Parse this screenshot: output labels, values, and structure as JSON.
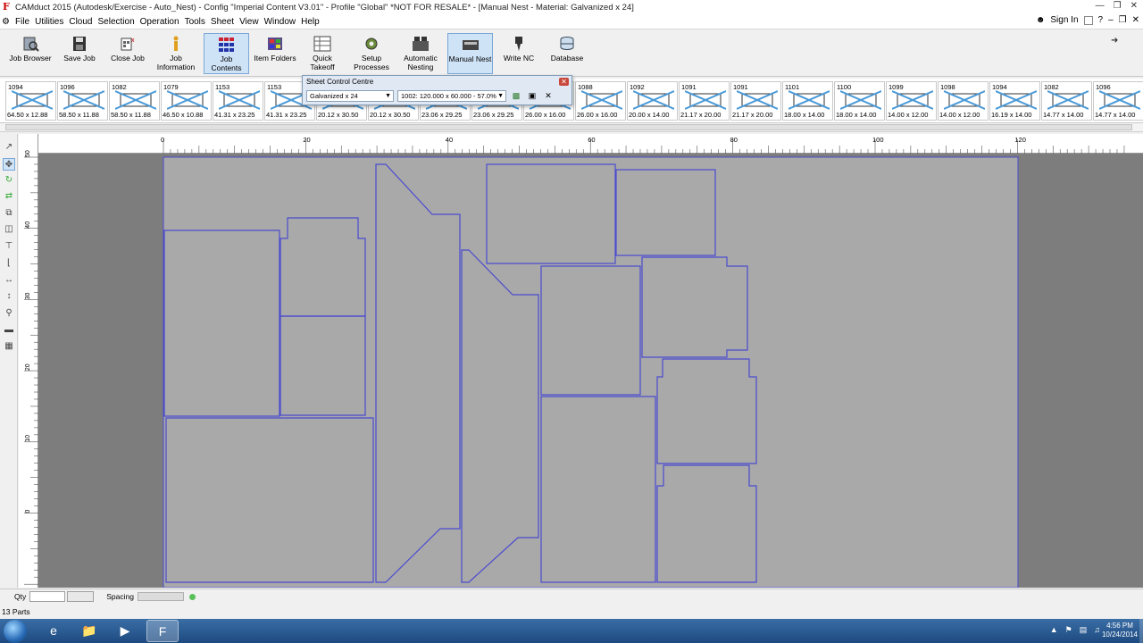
{
  "titlebar": {
    "icon": "F",
    "title": "CAMduct 2015 (Autodesk/Exercise - Auto_Nest) - Config \"Imperial Content V3.01\" - Profile \"Global\" *NOT FOR RESALE* - [Manual Nest - Material: Galvanized x 24]"
  },
  "menubar": {
    "items": [
      "File",
      "Utilities",
      "Cloud",
      "Selection",
      "Operation",
      "Tools",
      "Sheet",
      "View",
      "Window",
      "Help"
    ],
    "sign_in": "Sign In"
  },
  "toolbar": {
    "buttons": [
      {
        "label": "Job Browser",
        "icon": "job-browser-icon"
      },
      {
        "label": "Save Job",
        "icon": "save-icon"
      },
      {
        "label": "Close Job",
        "icon": "close-job-icon"
      },
      {
        "label": "Job Information",
        "icon": "info-icon"
      },
      {
        "label": "Job Contents",
        "icon": "grid-icon",
        "active": true
      },
      {
        "label": "Item Folders",
        "icon": "folders-icon"
      },
      {
        "label": "Quick Takeoff",
        "icon": "takeoff-icon"
      },
      {
        "label": "Setup Processes",
        "icon": "gear-icon"
      },
      {
        "label": "Automatic Nesting",
        "icon": "auto-nest-icon"
      },
      {
        "label": "Manual Nest",
        "icon": "manual-nest-icon",
        "active": true
      },
      {
        "label": "Write NC",
        "icon": "write-nc-icon"
      },
      {
        "label": "Database",
        "icon": "database-icon"
      }
    ]
  },
  "parts": [
    {
      "num": "1094",
      "dims": "64.50 x 12.88"
    },
    {
      "num": "1096",
      "dims": "58.50 x 11.88"
    },
    {
      "num": "1082",
      "dims": "58.50 x 11.88"
    },
    {
      "num": "1079",
      "dims": "46.50 x 10.88"
    },
    {
      "num": "1153",
      "dims": "41.31 x 23.25"
    },
    {
      "num": "1153",
      "dims": "41.31 x 23.25"
    },
    {
      "num": "",
      "dims": "20.12 x 30.50"
    },
    {
      "num": "",
      "dims": "20.12 x 30.50"
    },
    {
      "num": "",
      "dims": "23.06 x 29.25"
    },
    {
      "num": "",
      "dims": "23.06 x 29.25"
    },
    {
      "num": "",
      "dims": "26.00 x 16.00"
    },
    {
      "num": "1088",
      "dims": "26.00 x 16.00"
    },
    {
      "num": "1092",
      "dims": "20.00 x 14.00"
    },
    {
      "num": "1091",
      "dims": "21.17 x 20.00"
    },
    {
      "num": "1091",
      "dims": "21.17 x 20.00"
    },
    {
      "num": "1101",
      "dims": "18.00 x 14.00"
    },
    {
      "num": "1100",
      "dims": "18.00 x 14.00"
    },
    {
      "num": "1099",
      "dims": "14.00 x 12.00"
    },
    {
      "num": "1098",
      "dims": "14.00 x 12.00"
    },
    {
      "num": "1094",
      "dims": "16.19 x 14.00"
    },
    {
      "num": "1082",
      "dims": "14.77 x 14.00"
    },
    {
      "num": "1096",
      "dims": "14.77 x 14.00"
    }
  ],
  "sheet_control": {
    "title": "Sheet Control Centre",
    "material": "Galvanized x 24",
    "sheet": "1002: 120.000 x 60.000 - 57.0%"
  },
  "rulers": {
    "h_labels": [
      "0",
      "20",
      "40",
      "60",
      "80",
      "100",
      "120"
    ],
    "v_labels": [
      "0",
      "10",
      "20",
      "30",
      "40",
      "50"
    ]
  },
  "qty": {
    "label": "Qty",
    "spacing_label": "Spacing"
  },
  "status": {
    "text": "13 Parts"
  },
  "clock": {
    "time": "4:56 PM",
    "date": "10/24/2014"
  },
  "colors": {
    "sheet": "#a9a9a9",
    "outline": "#4b4bd0",
    "background": "#7d7d7d"
  }
}
